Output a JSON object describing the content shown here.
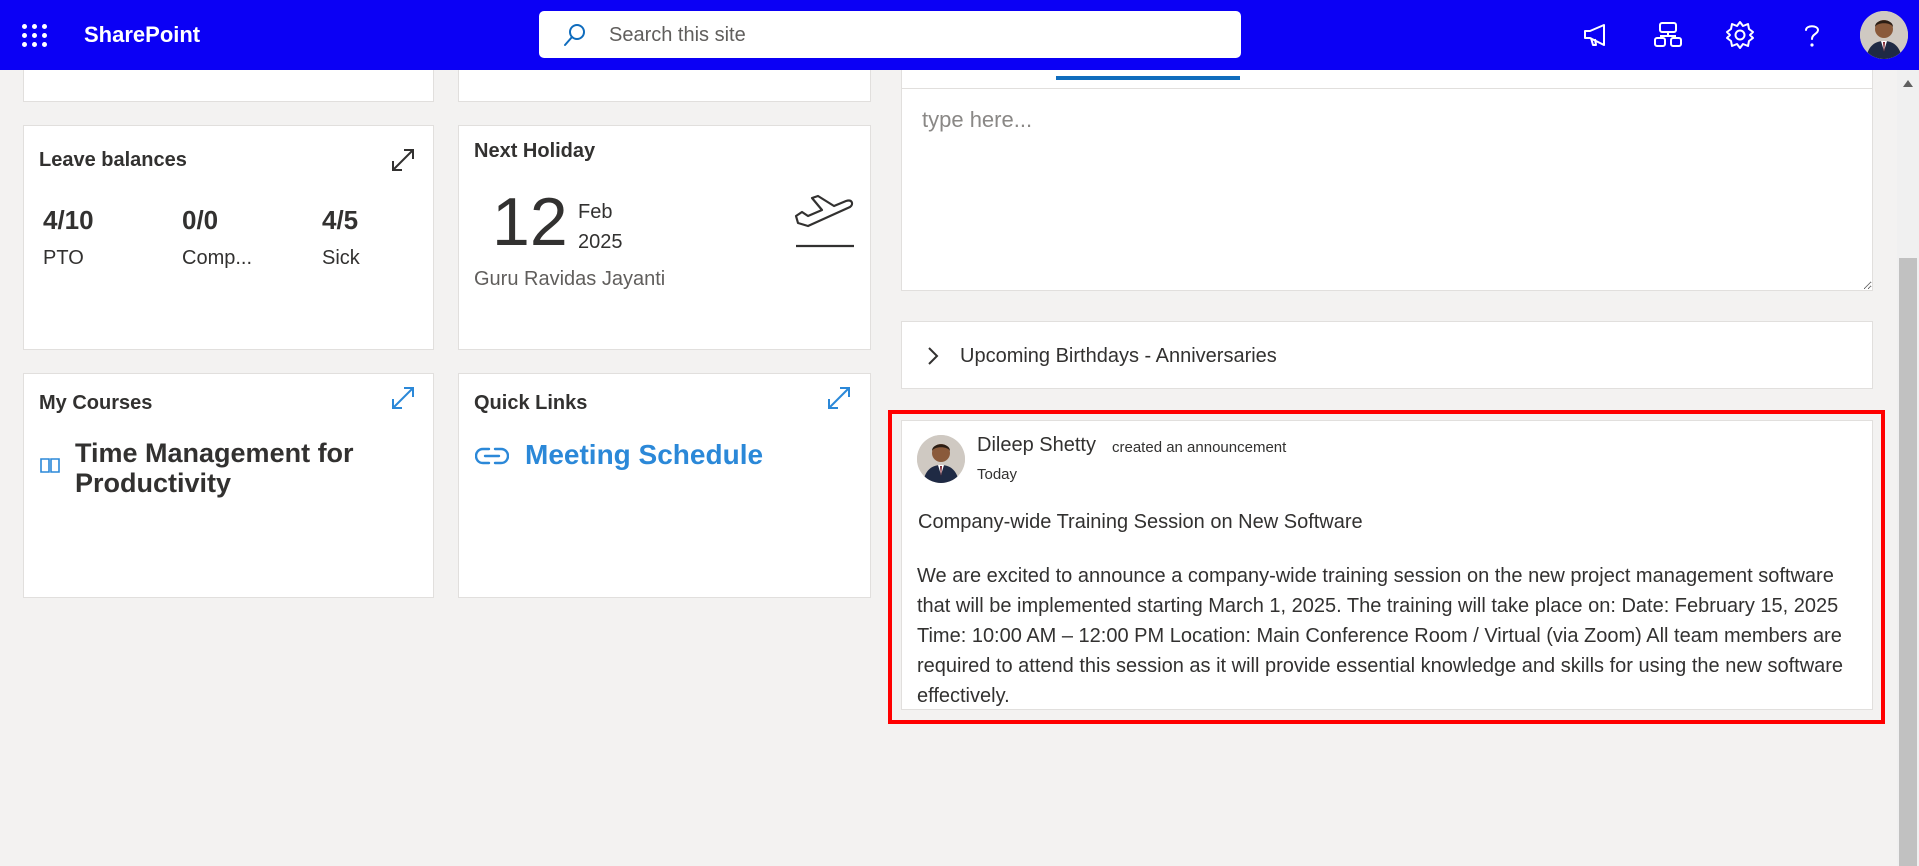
{
  "header": {
    "app_name": "SharePoint",
    "search_placeholder": "Search this site",
    "icons": [
      "waffle-icon",
      "search-icon",
      "megaphone-icon",
      "chat-tree-icon",
      "gear-icon",
      "help-icon",
      "avatar"
    ],
    "bar_color": "#0b00f5"
  },
  "leave_balances": {
    "title": "Leave balances",
    "items": [
      {
        "value": "4/10",
        "label": "PTO"
      },
      {
        "value": "0/0",
        "label": "Comp..."
      },
      {
        "value": "4/5",
        "label": "Sick"
      }
    ]
  },
  "next_holiday": {
    "title": "Next Holiday",
    "day": "12",
    "month": "Feb",
    "year": "2025",
    "name": "Guru Ravidas Jayanti",
    "icon": "airplane-takeoff-icon"
  },
  "my_courses": {
    "title": "My Courses",
    "course": "Time Management for Productivity",
    "icon": "book-icon"
  },
  "quick_links": {
    "title": "Quick Links",
    "link": "Meeting Schedule",
    "icon": "link-icon",
    "link_color": "#2b88d8"
  },
  "editor": {
    "placeholder": "type here..."
  },
  "accordion": {
    "label": "Upcoming Birthdays - Anniversaries"
  },
  "announcement": {
    "author": "Dileep Shetty",
    "action": "created an announcement",
    "time": "Today",
    "title": "Company-wide Training Session on New Software",
    "body": "We are excited to announce a company-wide training session on the new project management software that will be implemented starting March 1, 2025. The training will take place on: Date: February 15, 2025 Time: 10:00 AM – 12:00 PM Location: Main Conference Room / Virtual (via Zoom) All team members are required to attend this session as it will provide essential knowledge and skills for using the new software effectively.",
    "highlight_color": "#ff0000"
  }
}
